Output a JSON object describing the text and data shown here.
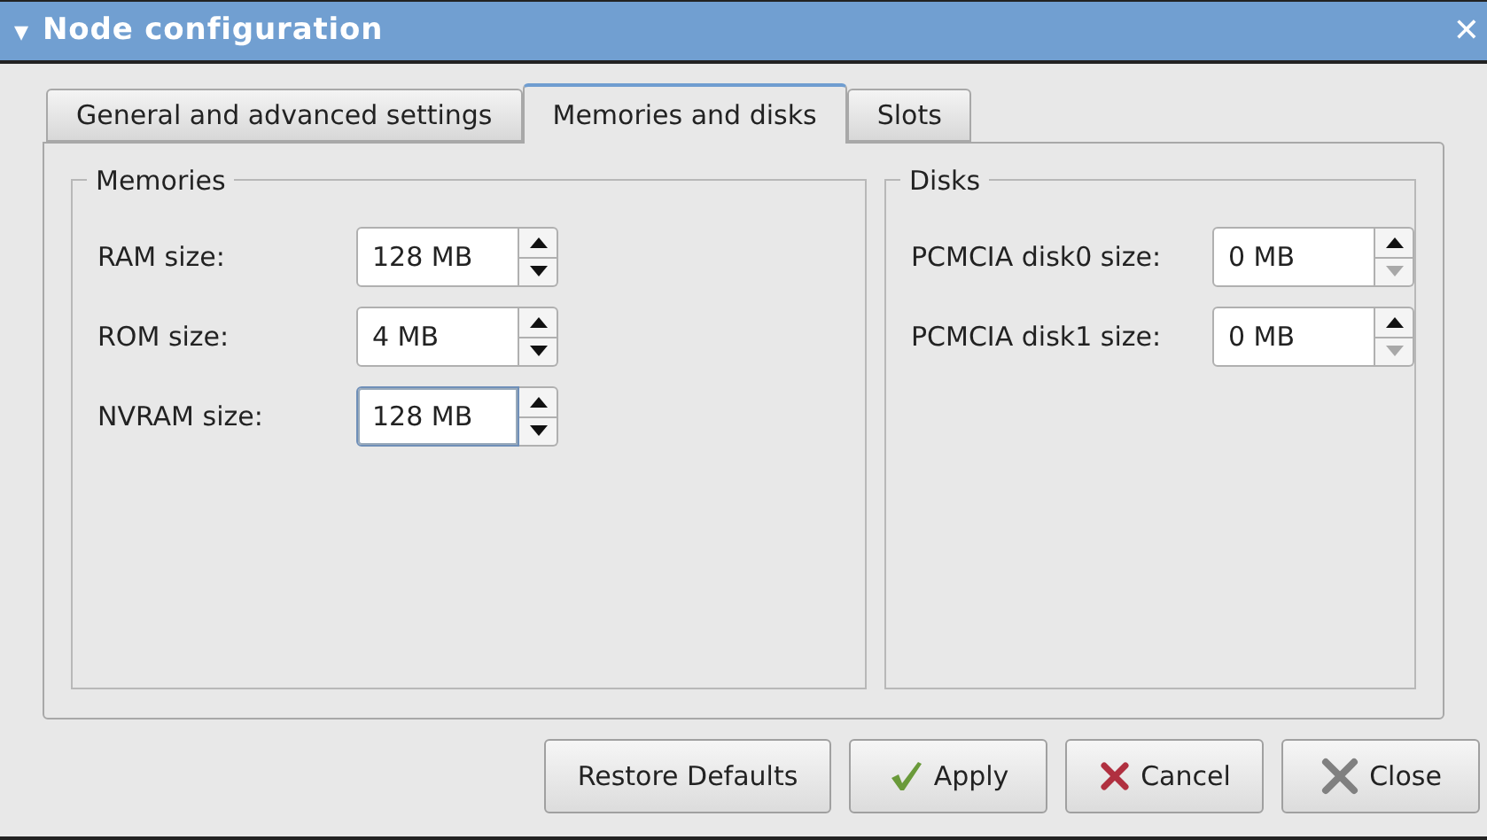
{
  "window": {
    "title": "Node configuration",
    "menu_glyph": "▾",
    "close_glyph": "✕"
  },
  "tabs": [
    {
      "label": "General and advanced settings",
      "selected": false
    },
    {
      "label": "Memories and disks",
      "selected": true
    },
    {
      "label": "Slots",
      "selected": false
    }
  ],
  "groups": [
    {
      "title": "Memories",
      "fields": [
        {
          "label": "RAM size:",
          "value": "128 MB",
          "focused": false,
          "down_disabled": false
        },
        {
          "label": "ROM size:",
          "value": "4 MB",
          "focused": false,
          "down_disabled": false
        },
        {
          "label": "NVRAM size:",
          "value": "128 MB",
          "focused": true,
          "down_disabled": false
        }
      ]
    },
    {
      "title": "Disks",
      "fields": [
        {
          "label": "PCMCIA disk0 size:",
          "value": "0 MB",
          "focused": false,
          "down_disabled": true
        },
        {
          "label": "PCMCIA disk1 size:",
          "value": "0 MB",
          "focused": false,
          "down_disabled": true
        }
      ]
    }
  ],
  "buttons": [
    {
      "label": "Restore Defaults",
      "kind": "plain"
    },
    {
      "label": "Apply",
      "kind": "apply"
    },
    {
      "label": "Cancel",
      "kind": "cancel"
    },
    {
      "label": "Close",
      "kind": "close"
    }
  ]
}
